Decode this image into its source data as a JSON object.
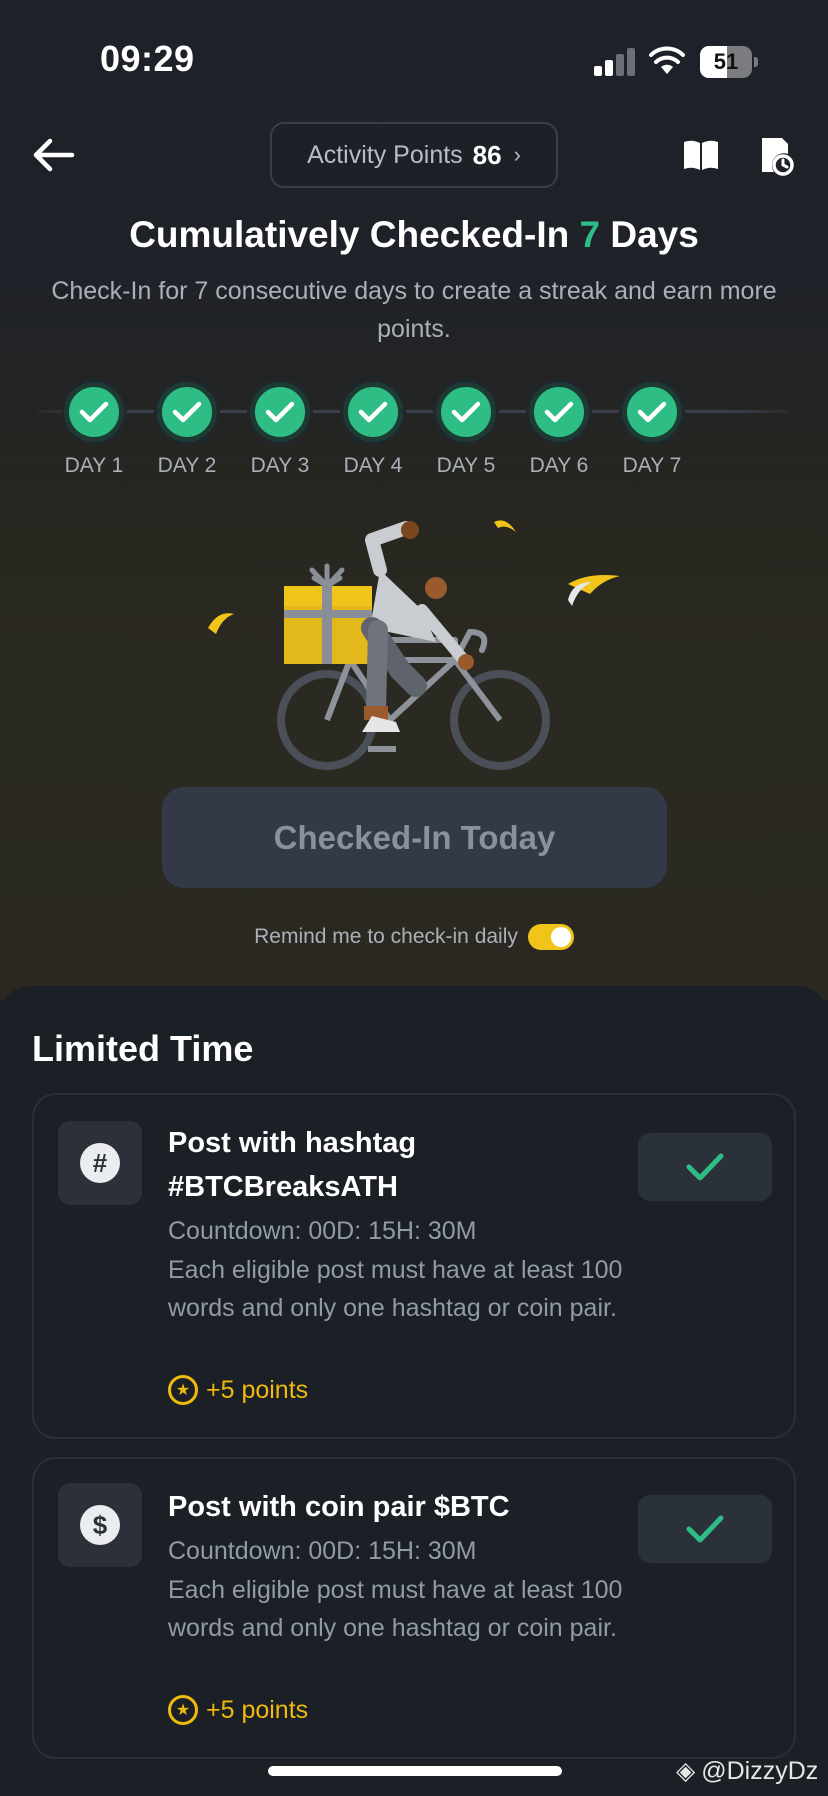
{
  "status_bar": {
    "time": "09:29",
    "battery": "51"
  },
  "header": {
    "points_label": "Activity Points",
    "points_value": "86",
    "points_chevron": "›"
  },
  "checkin": {
    "headline_prefix": "Cumulatively Checked-In",
    "headline_days": "7",
    "headline_suffix": "Days",
    "subtitle": "Check-In for 7 consecutive days to create a streak and earn more points.",
    "days": [
      "DAY 1",
      "DAY 2",
      "DAY 3",
      "DAY 4",
      "DAY 5",
      "DAY 6",
      "DAY 7"
    ],
    "button_label": "Checked-In Today",
    "remind_label": "Remind me to check-in daily",
    "remind_enabled": true
  },
  "limited": {
    "title": "Limited Time",
    "tasks": [
      {
        "icon": "hashtag-icon",
        "icon_glyph": "#",
        "title": "Post with hashtag #BTCBreaksATH",
        "countdown": "Countdown: 00D: 15H: 30M",
        "description": "Each eligible post must have at least 100 words and only one hashtag or coin pair.",
        "points": "+5 points",
        "completed": true
      },
      {
        "icon": "dollar-icon",
        "icon_glyph": "$",
        "title": "Post with coin pair $BTC",
        "countdown": "Countdown: 00D: 15H: 30M",
        "description": "Each eligible post must have at least 100 words and only one hashtag or coin pair.",
        "points": "+5 points",
        "completed": true
      }
    ]
  },
  "watermark": "@DizzyDz",
  "colors": {
    "accent_green": "#2ebd85",
    "accent_yellow": "#f0b90b",
    "button_bg": "#333947"
  }
}
